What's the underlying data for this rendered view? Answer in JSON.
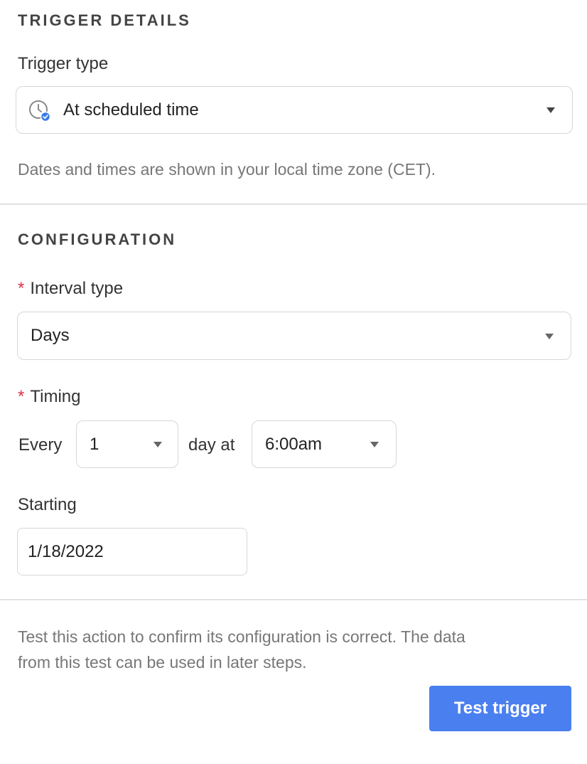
{
  "trigger_details": {
    "heading": "TRIGGER DETAILS",
    "trigger_type_label": "Trigger type",
    "trigger_type_value": "At scheduled time",
    "trigger_type_icon": "scheduled-clock-icon",
    "timezone_note": "Dates and times are shown in your local time zone (CET)."
  },
  "configuration": {
    "heading": "CONFIGURATION",
    "required_marker": "*",
    "interval_type_label": "Interval type",
    "interval_type_value": "Days",
    "timing_label": "Timing",
    "every_text": "Every",
    "every_value": "1",
    "day_at_text": "day at",
    "time_value": "6:00am",
    "starting_label": "Starting",
    "starting_value": "1/18/2022"
  },
  "test": {
    "note_line1": "Test this action to confirm its configuration is correct. The data",
    "note_line2": "from this test can be used in later steps.",
    "button_label": "Test trigger"
  },
  "colors": {
    "accent": "#4a7ff0",
    "required": "#e0304a"
  }
}
